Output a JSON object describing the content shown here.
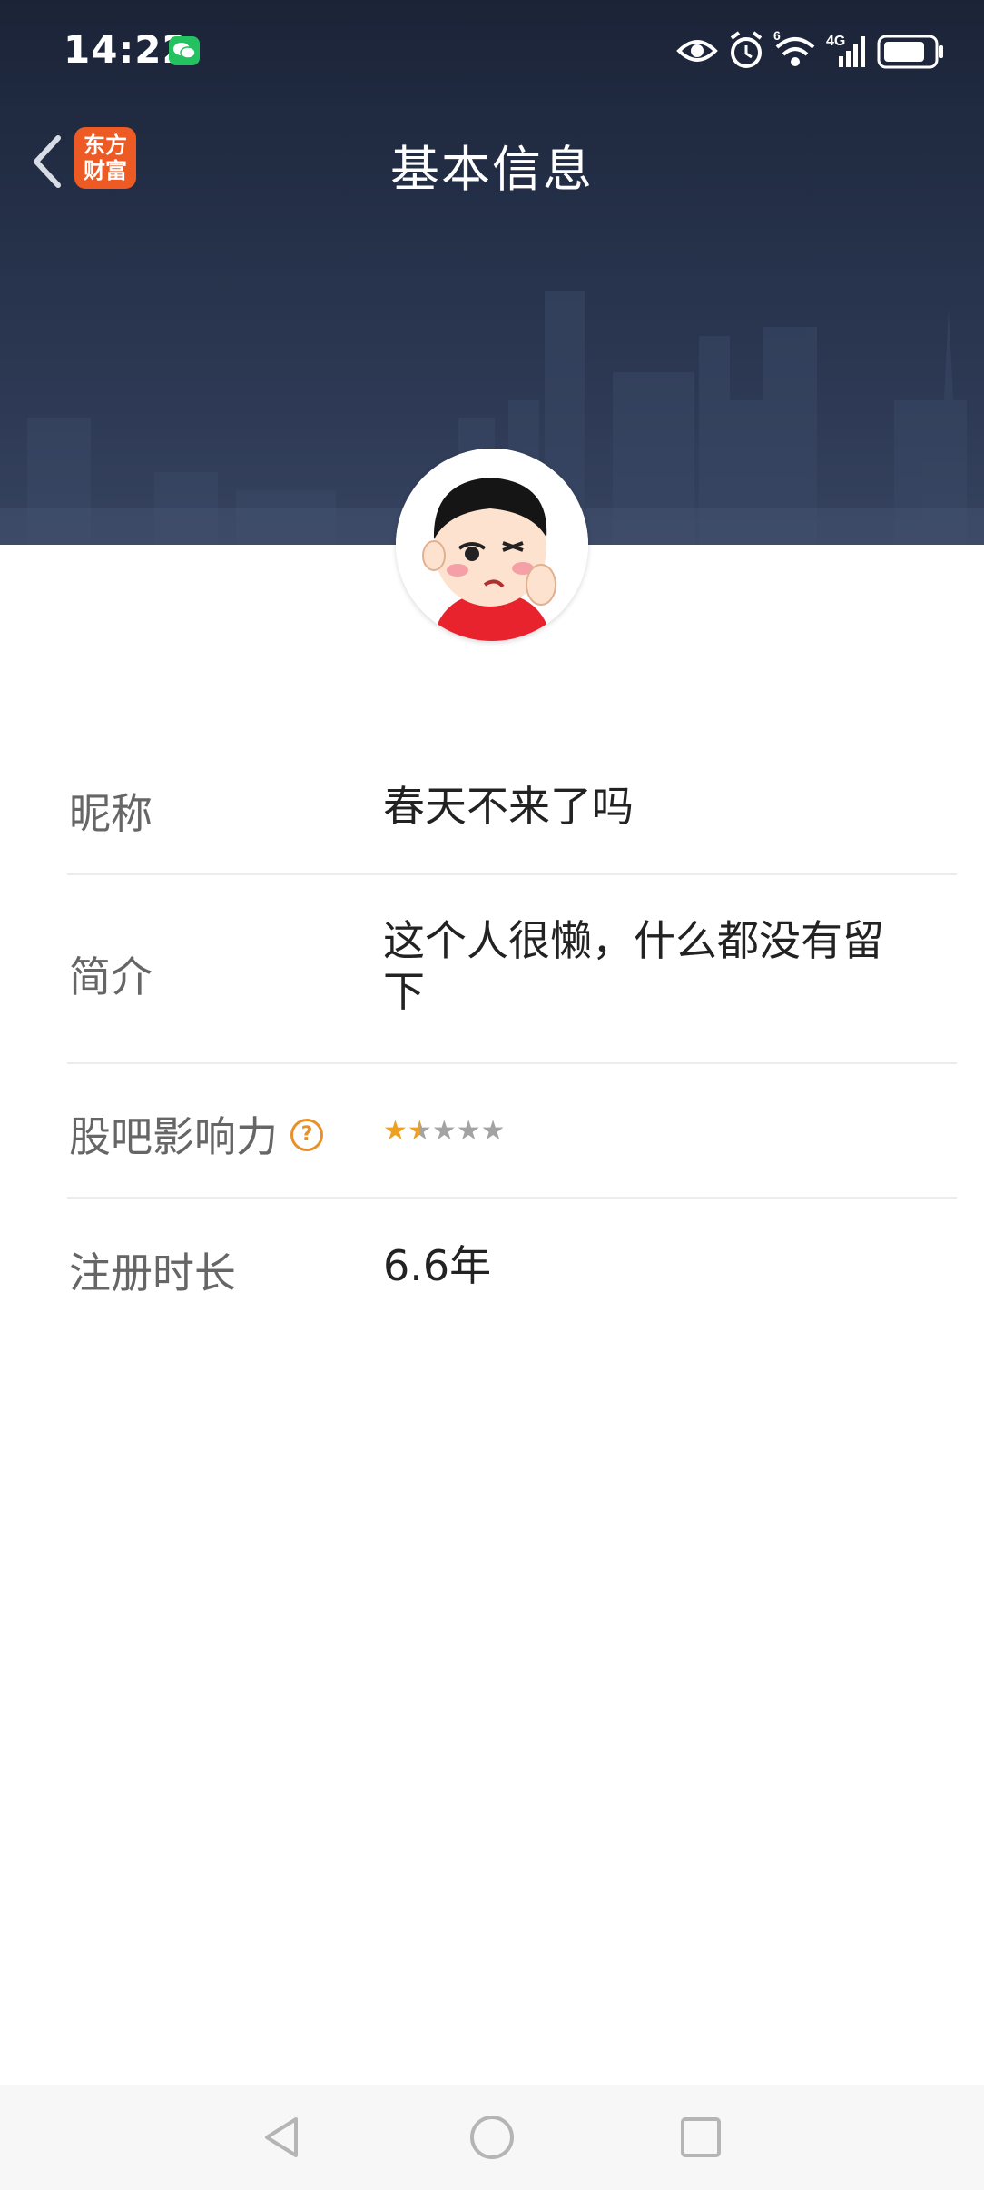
{
  "status_bar": {
    "time": "14:22",
    "notification_icons": [
      "wechat-icon"
    ],
    "system_icons": [
      "eye-icon",
      "alarm-icon",
      "wifi-6-icon",
      "signal-4g-icon",
      "battery-icon"
    ],
    "wifi_badge": "6",
    "network_badge": "4G"
  },
  "header": {
    "back_icon": "chevron-left-icon",
    "app_logo_line1": "东方",
    "app_logo_line2": "财富",
    "title": "基本信息",
    "banner_color": "#243048",
    "logo_color": "#ee5a24"
  },
  "profile": {
    "avatar": "cartoon-avatar",
    "fields": {
      "nickname": {
        "label": "昵称",
        "value": "春天不来了吗"
      },
      "intro": {
        "label": "简介",
        "value": "这个人很懒，什么都没有留下"
      },
      "influence": {
        "label": "股吧影响力",
        "help_icon": "question-circle-icon",
        "rating": 1.5,
        "max_rating": 5,
        "star_color": "#f0a020"
      },
      "duration": {
        "label": "注册时长",
        "value": "6.6年"
      }
    }
  },
  "system_nav": {
    "back": "triangle-back-icon",
    "home": "circle-home-icon",
    "recents": "square-recents-icon"
  }
}
